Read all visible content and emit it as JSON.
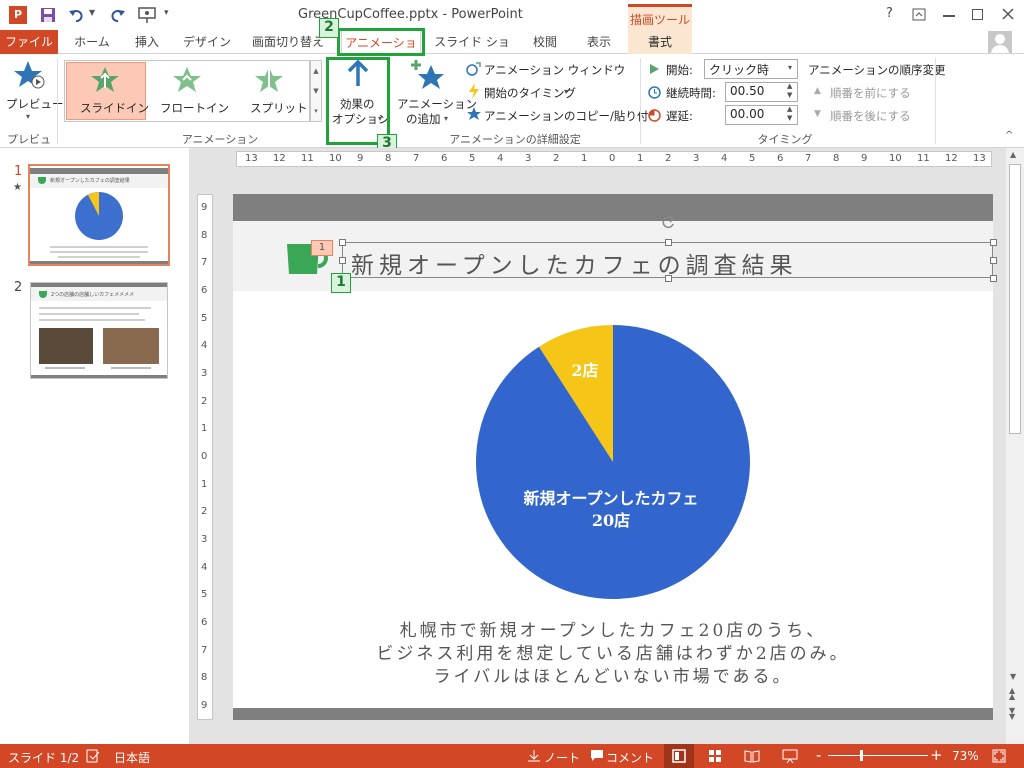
{
  "window": {
    "title": "GreenCupCoffee.pptx - PowerPoint",
    "help": "?"
  },
  "qat": {
    "app_icon": "powerpoint-icon",
    "save_icon": "save-icon",
    "undo_icon": "undo-icon",
    "redo_icon": "redo-icon",
    "start_icon": "present-from-beginning-icon"
  },
  "tabs": {
    "file": "ファイル",
    "home": "ホーム",
    "insert": "挿入",
    "design": "デザイン",
    "transitions": "画面切り替え",
    "animations": "アニメーション",
    "slideshow": "スライド ショー",
    "review": "校閲",
    "view": "表示",
    "contextual_group": "描画ツール",
    "format": "書式"
  },
  "ribbon": {
    "preview_label": "プレビュー",
    "preview_group": "プレビュー",
    "animations_group": "アニメーション",
    "gallery": [
      "スライドイン",
      "フロートイン",
      "スプリット"
    ],
    "effect_options_line1": "効果の",
    "effect_options_line2": "オプション",
    "add_anim_line1": "アニメーション",
    "add_anim_line2": "の追加",
    "anim_pane": "アニメーション ウィンドウ",
    "trigger": "開始のタイミング",
    "painter": "アニメーションのコピー/貼り付け",
    "advanced_group": "アニメーションの詳細設定",
    "start_label": "開始:",
    "start_value": "クリック時",
    "duration_label": "継続時間:",
    "duration_value": "00.50",
    "delay_label": "遅延:",
    "delay_value": "00.00",
    "timing_group": "タイミング",
    "reorder_title": "アニメーションの順序変更",
    "move_earlier": "順番を前にする",
    "move_later": "順番を後にする"
  },
  "markers": {
    "m1": "1",
    "m2": "2",
    "m3": "3"
  },
  "thumbs": {
    "n1": "1",
    "n2": "2",
    "t1_title": "新規オープンしたカフェの調査結果",
    "t2_title": "2つの店舗の店舗しいカフェメメメメ"
  },
  "ruler": {
    "h": [
      "13",
      "12",
      "11",
      "10",
      "9",
      "8",
      "7",
      "6",
      "5",
      "4",
      "3",
      "2",
      "1",
      "0",
      "1",
      "2",
      "3",
      "4",
      "5",
      "6",
      "7",
      "8",
      "9",
      "10",
      "11",
      "12",
      "13"
    ],
    "v": [
      "9",
      "8",
      "7",
      "6",
      "5",
      "4",
      "3",
      "2",
      "1",
      "0",
      "1",
      "2",
      "3",
      "4",
      "5",
      "6",
      "7",
      "8",
      "9"
    ]
  },
  "slide": {
    "title": "新規オープンしたカフェの調査結果",
    "anim_tag": "1",
    "body_lines": [
      "札幌市で新規オープンしたカフェ20店のうち、",
      "ビジネス利用を想定している店舗はわずか2店のみ。",
      "ライバルはほとんどいない市場である。"
    ]
  },
  "chart_data": {
    "type": "pie",
    "categories": [
      "2店",
      "新規オープンしたカフェ 20店"
    ],
    "values": [
      2,
      20
    ],
    "labels": [
      "2店",
      "新規オープンしたカフェ",
      "20店"
    ],
    "colors": [
      "#f5c518",
      "#3366cc"
    ]
  },
  "status": {
    "slide": "スライド 1/2",
    "lang": "日本語",
    "notes": "ノート",
    "comments": "コメント",
    "zoom": "73%",
    "zoom_minus": "-",
    "zoom_plus": "+"
  }
}
